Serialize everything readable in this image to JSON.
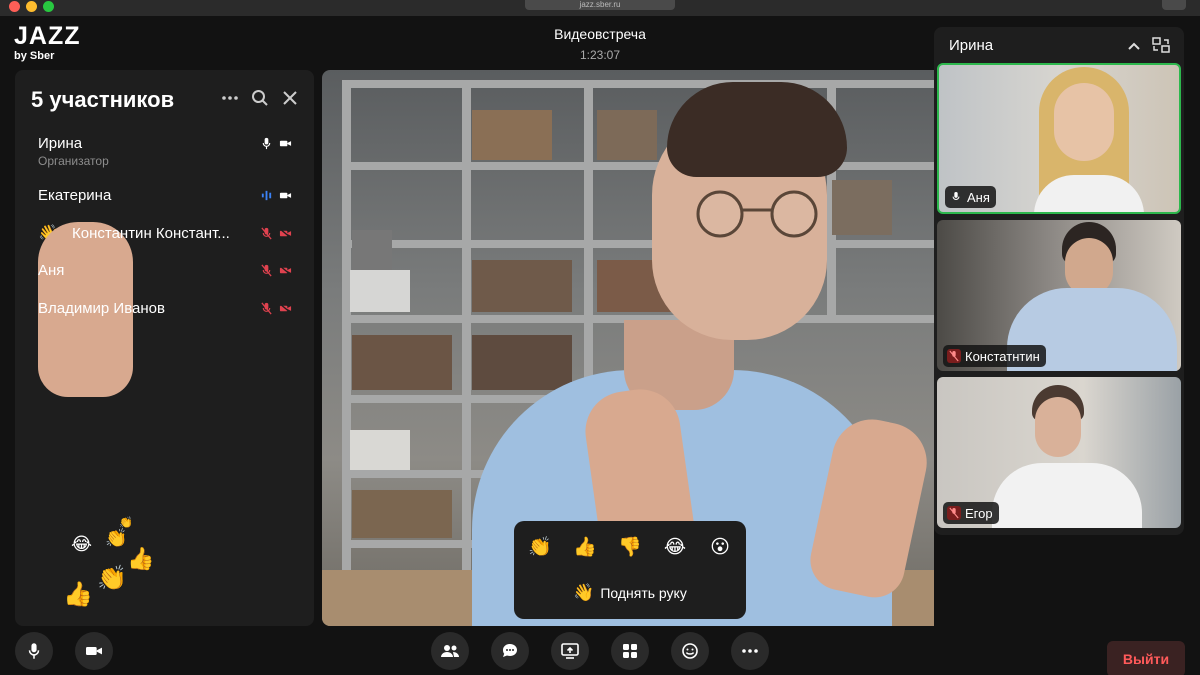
{
  "browser": {
    "url": "jazz.sber.ru"
  },
  "app": {
    "logo_main": "JAZZ",
    "logo_sub": "by Sber"
  },
  "meeting": {
    "title": "Видеовстреча",
    "timer": "1:23:07"
  },
  "participants_panel": {
    "title": "5 участников",
    "items": [
      {
        "name": "Ирина",
        "role": "Организатор",
        "mic": "on",
        "camera": "on",
        "hand_raised": false
      },
      {
        "name": "Екатерина",
        "role": "",
        "mic": "speaking",
        "camera": "on",
        "hand_raised": false
      },
      {
        "name": "Константин Констант...",
        "role": "",
        "mic": "off",
        "camera": "off",
        "hand_raised": true
      },
      {
        "name": "Аня",
        "role": "",
        "mic": "off",
        "camera": "off",
        "hand_raised": false
      },
      {
        "name": "Владимир Иванов",
        "role": "",
        "mic": "off",
        "camera": "off",
        "hand_raised": false
      }
    ]
  },
  "floating_reactions": [
    "😂",
    "👏",
    "👍",
    "👏",
    "👍",
    "👏"
  ],
  "reactions_popup": {
    "reactions": [
      "👏",
      "👍",
      "👎",
      "😂",
      "😮"
    ],
    "raise_hand_icon": "👋",
    "raise_hand_label": "Поднять руку"
  },
  "side_tiles": {
    "header": "Ирина",
    "tiles": [
      {
        "label": "Аня",
        "mic": "on",
        "active": true
      },
      {
        "label": "Констатнтин",
        "mic": "off",
        "active": false
      },
      {
        "label": "Егор",
        "mic": "off",
        "active": false
      }
    ]
  },
  "toolbar": {
    "leave_label": "Выйти",
    "left_buttons": [
      "microphone-icon",
      "camera-icon"
    ],
    "center_buttons": [
      "participants-icon",
      "chat-icon",
      "screen-share-icon",
      "layout-grid-icon",
      "emoji-icon",
      "more-icon"
    ]
  },
  "colors": {
    "accent_green": "#2db84d",
    "danger": "#ff5a5a",
    "mic_off": "#e0424f",
    "speaking": "#3b82f6"
  }
}
